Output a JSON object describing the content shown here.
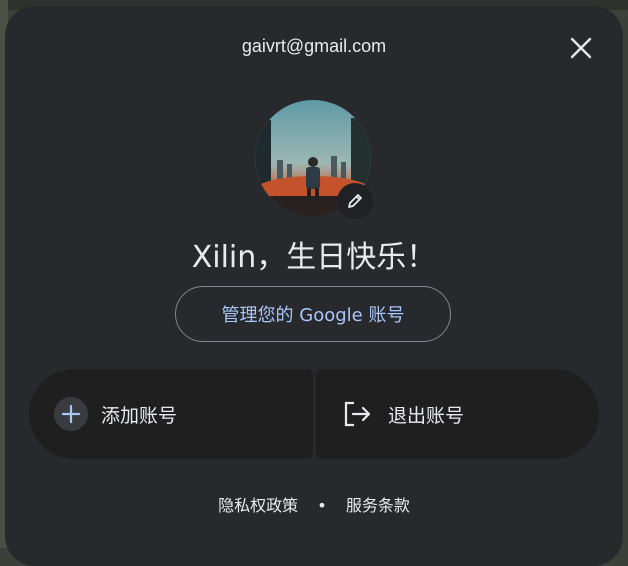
{
  "account": {
    "email": "gaivrt@gmail.com",
    "greeting": "Xilin，生日快乐！",
    "manage_label": "管理您的 Google 账号"
  },
  "actions": {
    "add_account": "添加账号",
    "sign_out": "退出账号"
  },
  "footer": {
    "privacy": "隐私权政策",
    "separator": "•",
    "terms": "服务条款"
  },
  "icons": {
    "close": "close-icon",
    "edit": "pencil-icon",
    "add": "plus-icon",
    "signout": "logout-icon"
  },
  "colors": {
    "panel": "#28292c",
    "accent_link": "#a8c7fa",
    "action_bg": "#1f1f1f"
  }
}
